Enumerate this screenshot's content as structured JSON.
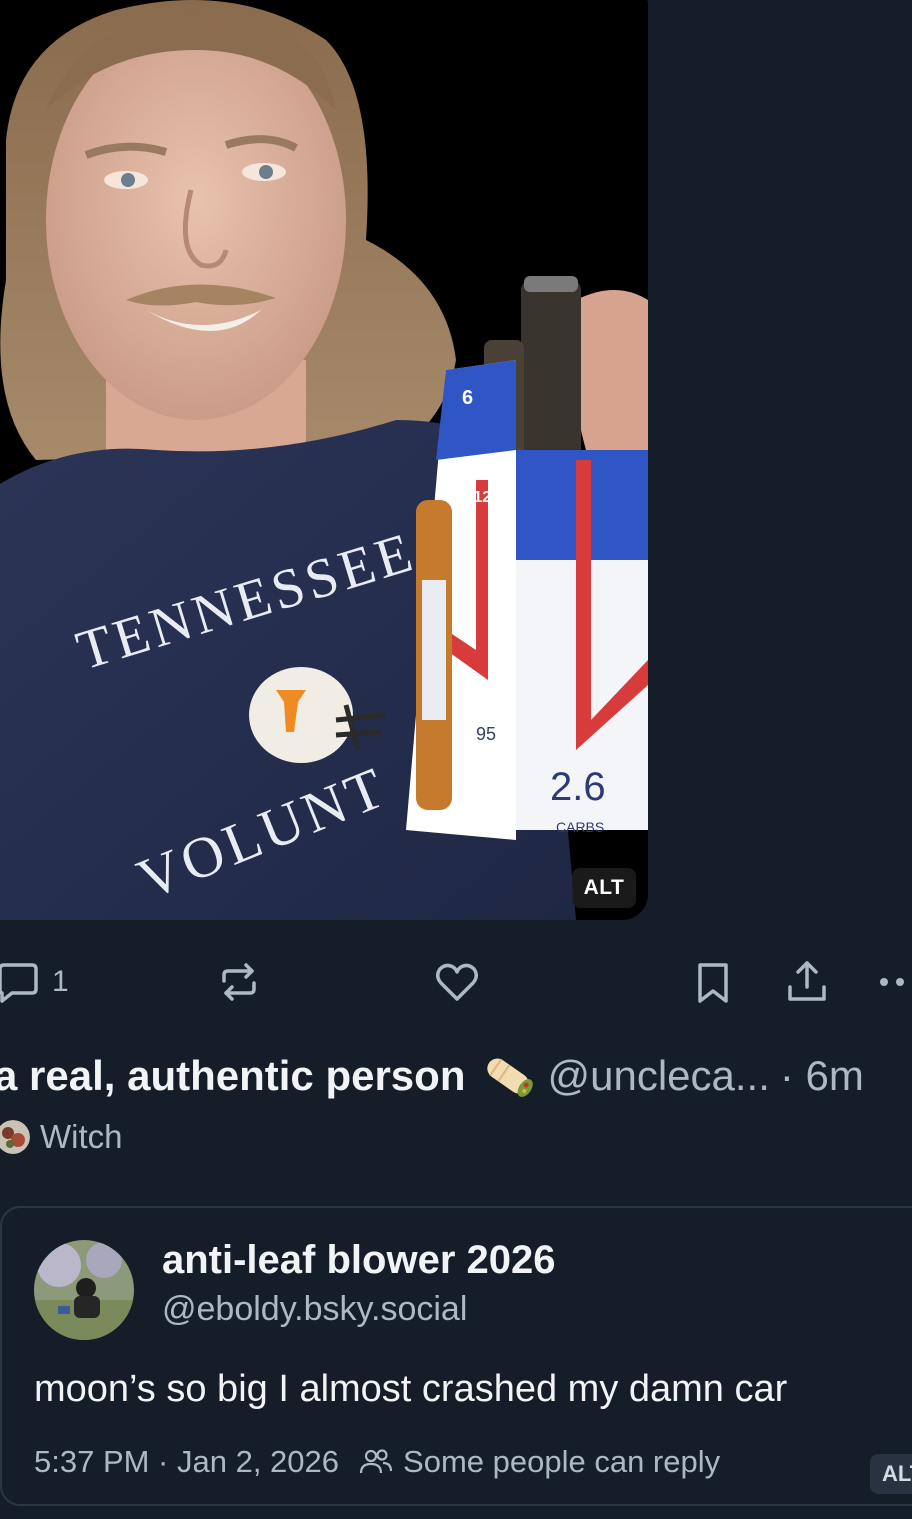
{
  "media": {
    "alt_badge": "ALT",
    "shirt_text_top": "TENNESSEE",
    "shirt_text_bottom": "VOLUNT",
    "pack_top_number": "6",
    "pack_side_numbers": "6 12",
    "calories_label": "95",
    "carbs_value": "2.6",
    "carbs_label": "CARBS"
  },
  "actions": {
    "reply_count": "1",
    "icons": [
      "reply-icon",
      "repost-icon",
      "like-icon",
      "bookmark-icon",
      "share-icon",
      "more-icon"
    ]
  },
  "reposter": {
    "name": "a real, authentic person",
    "handle": "@uncleca...",
    "time_partial": "· 6m",
    "label": "Witch"
  },
  "quote": {
    "author_name": "anti-leaf blower 2026",
    "author_handle": "@eboldy.bsky.social",
    "text": "moon’s so big I almost crashed my damn car",
    "timestamp": "5:37 PM · Jan 2, 2026",
    "reply_setting": "Some people can reply",
    "alt_badge": "ALT"
  },
  "colors": {
    "background": "#151d28",
    "text_primary": "#f1f3f5",
    "text_secondary": "#aeb8c5",
    "card_border": "#2b3644"
  }
}
